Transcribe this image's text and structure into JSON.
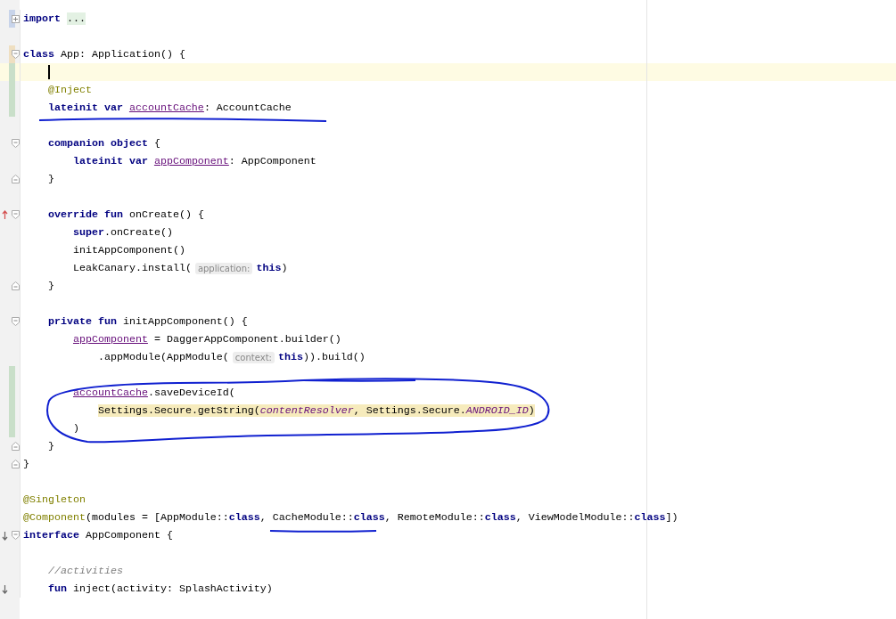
{
  "lines": [
    {
      "current": false,
      "marks": [
        {
          "kind": "folded_region"
        },
        {
          "kind": "fold_collapsed"
        }
      ],
      "tokens": [
        {
          "kind": "kw",
          "text": "import "
        },
        {
          "kind": "folded",
          "text": "..."
        }
      ]
    },
    {
      "current": false
    },
    {
      "current": false,
      "marks": [
        {
          "kind": "modified"
        },
        {
          "kind": "fold_start"
        }
      ],
      "tokens": [
        {
          "kind": "kw",
          "text": "class"
        },
        {
          "kind": "plain",
          "text": " App: Application() {"
        }
      ]
    },
    {
      "current": true,
      "marks": [
        {
          "kind": "added"
        }
      ]
    },
    {
      "current": false,
      "marks": [
        {
          "kind": "added"
        }
      ],
      "tokens": [
        {
          "kind": "ann",
          "text": "    @Inject"
        }
      ]
    },
    {
      "current": false,
      "marks": [
        {
          "kind": "added"
        }
      ],
      "tokens": [
        {
          "kind": "kw",
          "text": "    lateinit var "
        },
        {
          "kind": "prop",
          "text": "accountCache"
        },
        {
          "kind": "plain",
          "text": ": AccountCache"
        }
      ]
    },
    {
      "current": false
    },
    {
      "current": false,
      "marks": [
        {
          "kind": "fold_start"
        }
      ],
      "tokens": [
        {
          "kind": "kw",
          "text": "    companion object"
        },
        {
          "kind": "plain",
          "text": " {"
        }
      ]
    },
    {
      "current": false,
      "tokens": [
        {
          "kind": "kw",
          "text": "        lateinit var "
        },
        {
          "kind": "prop",
          "text": "appComponent"
        },
        {
          "kind": "plain",
          "text": ": AppComponent"
        }
      ]
    },
    {
      "current": false,
      "marks": [
        {
          "kind": "fold_end"
        }
      ],
      "tokens": [
        {
          "kind": "plain",
          "text": "    }"
        }
      ]
    },
    {
      "current": false
    },
    {
      "current": false,
      "marks": [
        {
          "kind": "overrides"
        },
        {
          "kind": "fold_start"
        }
      ],
      "tokens": [
        {
          "kind": "kw",
          "text": "    override fun"
        },
        {
          "kind": "plain",
          "text": " onCreate() {"
        }
      ]
    },
    {
      "current": false,
      "tokens": [
        {
          "kind": "kw",
          "text": "        super"
        },
        {
          "kind": "plain",
          "text": ".onCreate()"
        }
      ]
    },
    {
      "current": false,
      "tokens": [
        {
          "kind": "plain",
          "text": "        initAppComponent()"
        }
      ]
    },
    {
      "current": false,
      "tokens": [
        {
          "kind": "plain",
          "text": "        LeakCanary.install("
        },
        {
          "kind": "hint",
          "text": "application:"
        },
        {
          "kind": "kw",
          "text": "this"
        },
        {
          "kind": "plain",
          "text": ")"
        }
      ]
    },
    {
      "current": false,
      "marks": [
        {
          "kind": "fold_end"
        }
      ],
      "tokens": [
        {
          "kind": "plain",
          "text": "    }"
        }
      ]
    },
    {
      "current": false
    },
    {
      "current": false,
      "marks": [
        {
          "kind": "fold_start"
        }
      ],
      "tokens": [
        {
          "kind": "kw",
          "text": "    private fun"
        },
        {
          "kind": "plain",
          "text": " initAppComponent() {"
        }
      ]
    },
    {
      "current": false,
      "tokens": [
        {
          "kind": "prop",
          "text": "        appComponent"
        },
        {
          "kind": "plain",
          "text": " = DaggerAppComponent.builder()"
        }
      ]
    },
    {
      "current": false,
      "tokens": [
        {
          "kind": "plain",
          "text": "            .appModule(AppModule("
        },
        {
          "kind": "hint",
          "text": "context:"
        },
        {
          "kind": "kw",
          "text": "this"
        },
        {
          "kind": "plain",
          "text": ")).build()"
        }
      ]
    },
    {
      "current": false,
      "marks": [
        {
          "kind": "added"
        }
      ]
    },
    {
      "current": false,
      "marks": [
        {
          "kind": "added"
        }
      ],
      "tokens": [
        {
          "kind": "prop",
          "text": "        accountCache"
        },
        {
          "kind": "plain",
          "text": ".saveDeviceId("
        }
      ]
    },
    {
      "current": false,
      "marks": [
        {
          "kind": "added"
        }
      ],
      "tokens": [
        {
          "kind": "plain",
          "text": "            Settings.Secure.getString(",
          "highlighted": true
        },
        {
          "kind": "param",
          "text": "contentResolver",
          "highlighted": true
        },
        {
          "kind": "plain",
          "text": ", Settings.Secure.",
          "highlighted": true
        },
        {
          "kind": "const",
          "text": "ANDROID_ID",
          "highlighted": true
        },
        {
          "kind": "plain",
          "text": ")",
          "highlighted": true
        }
      ]
    },
    {
      "current": false,
      "marks": [
        {
          "kind": "added"
        }
      ],
      "tokens": [
        {
          "kind": "plain",
          "text": "        )"
        }
      ]
    },
    {
      "current": false,
      "marks": [
        {
          "kind": "fold_end"
        }
      ],
      "tokens": [
        {
          "kind": "plain",
          "text": "    }"
        }
      ]
    },
    {
      "current": false,
      "marks": [
        {
          "kind": "fold_end"
        }
      ],
      "tokens": [
        {
          "kind": "plain",
          "text": "}"
        }
      ]
    },
    {
      "current": false
    },
    {
      "current": false,
      "tokens": [
        {
          "kind": "ann",
          "text": "@Singleton"
        }
      ]
    },
    {
      "current": false,
      "tokens": [
        {
          "kind": "ann",
          "text": "@Component"
        },
        {
          "kind": "plain",
          "text": "(modules = [AppModule::"
        },
        {
          "kind": "kw",
          "text": "class"
        },
        {
          "kind": "plain",
          "text": ", CacheModule::"
        },
        {
          "kind": "kw",
          "text": "class"
        },
        {
          "kind": "plain",
          "text": ", RemoteModule::"
        },
        {
          "kind": "kw",
          "text": "class"
        },
        {
          "kind": "plain",
          "text": ", ViewModelModule::"
        },
        {
          "kind": "kw",
          "text": "class"
        },
        {
          "kind": "plain",
          "text": "])"
        }
      ]
    },
    {
      "current": false,
      "marks": [
        {
          "kind": "implemented"
        },
        {
          "kind": "fold_start"
        }
      ],
      "tokens": [
        {
          "kind": "kw",
          "text": "interface"
        },
        {
          "kind": "plain",
          "text": " AppComponent {"
        }
      ]
    },
    {
      "current": false
    },
    {
      "current": false,
      "tokens": [
        {
          "kind": "comment",
          "text": "    //activities"
        }
      ]
    },
    {
      "current": false,
      "marks": [
        {
          "kind": "implemented"
        }
      ],
      "tokens": [
        {
          "kind": "kw",
          "text": "    fun"
        },
        {
          "kind": "plain",
          "text": " inject(activity: SplashActivity)"
        }
      ]
    }
  ]
}
